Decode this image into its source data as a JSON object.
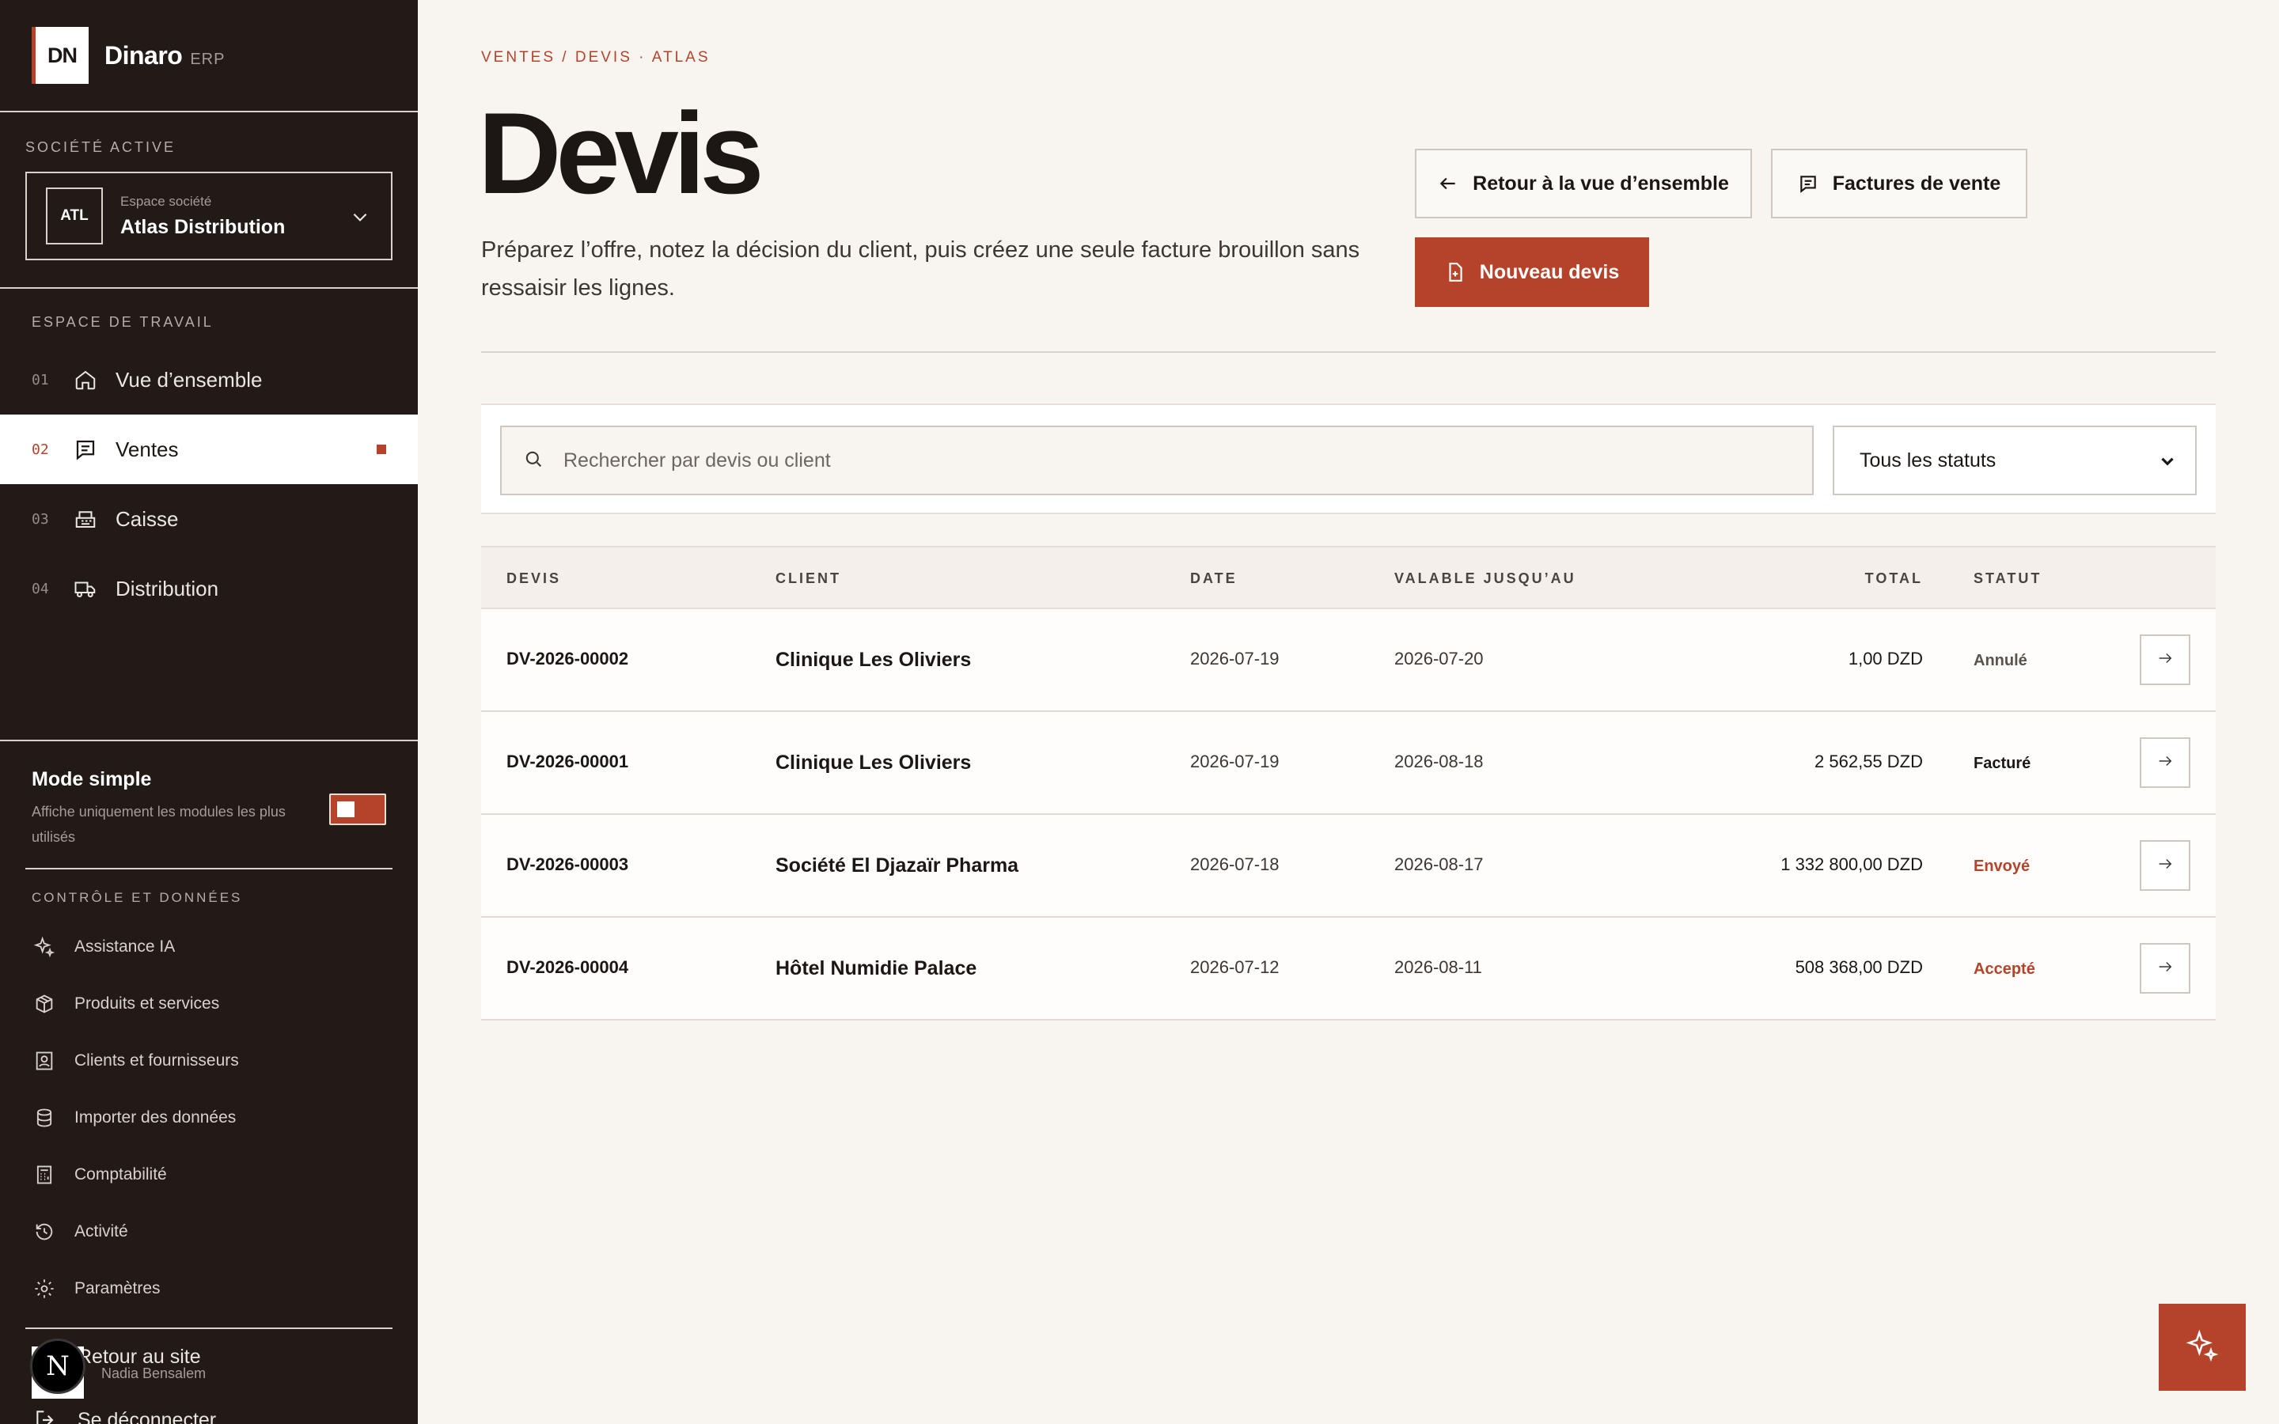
{
  "brand": {
    "logo": "DN",
    "name": "Dinaro",
    "suffix": "ERP"
  },
  "company": {
    "section_label": "SOCIÉTÉ ACTIVE",
    "badge": "ATL",
    "subtitle": "Espace société",
    "name": "Atlas Distribution"
  },
  "workspace": {
    "section_label": "ESPACE DE TRAVAIL",
    "items": [
      {
        "num": "01",
        "label": "Vue d’ensemble",
        "icon": "home-icon"
      },
      {
        "num": "02",
        "label": "Ventes",
        "icon": "receipt-icon",
        "active": true
      },
      {
        "num": "03",
        "label": "Caisse",
        "icon": "cash-register-icon"
      },
      {
        "num": "04",
        "label": "Distribution",
        "icon": "truck-icon"
      }
    ]
  },
  "simple_mode": {
    "title": "Mode simple",
    "description": "Affiche uniquement les modules les plus utilisés",
    "enabled": true
  },
  "control": {
    "section_label": "CONTRÔLE ET DONNÉES",
    "items": [
      {
        "label": "Assistance IA",
        "icon": "sparkles-icon"
      },
      {
        "label": "Produits et services",
        "icon": "box-icon"
      },
      {
        "label": "Clients et fournisseurs",
        "icon": "contacts-icon"
      },
      {
        "label": "Importer des données",
        "icon": "database-icon"
      },
      {
        "label": "Comptabilité",
        "icon": "calculator-icon"
      },
      {
        "label": "Activité",
        "icon": "history-icon"
      },
      {
        "label": "Paramètres",
        "icon": "gear-icon"
      }
    ]
  },
  "bottom_links": [
    {
      "label": "Retour au site",
      "icon": "arrow-left-icon"
    },
    {
      "label": "Se déconnecter",
      "icon": "logout-icon"
    }
  ],
  "user": {
    "initial": "N",
    "name": "Nadia Bensalem"
  },
  "page": {
    "breadcrumb": "VENTES / DEVIS · ATLAS",
    "title": "Devis",
    "intro": "Préparez l’offre, notez la décision du client, puis créez une seule facture brouillon sans ressaisir les lignes.",
    "buttons": {
      "back": "Retour à la vue d’ensemble",
      "invoices": "Factures de vente",
      "new": "Nouveau devis"
    }
  },
  "filters": {
    "search_placeholder": "Rechercher par devis ou client",
    "status_selected": "Tous les statuts"
  },
  "table": {
    "headers": {
      "number": "DEVIS",
      "client": "CLIENT",
      "date": "DATE",
      "valid_until": "VALABLE JUSQU’AU",
      "total": "TOTAL",
      "status": "STATUT"
    },
    "rows": [
      {
        "number": "DV-2026-00002",
        "client": "Clinique Les Oliviers",
        "date": "2026-07-19",
        "valid_until": "2026-07-20",
        "total": "1,00 DZD",
        "status": "Annulé",
        "status_color": "#5a524c"
      },
      {
        "number": "DV-2026-00001",
        "client": "Clinique Les Oliviers",
        "date": "2026-07-19",
        "valid_until": "2026-08-18",
        "total": "2 562,55 DZD",
        "status": "Facturé",
        "status_color": "#1c1714"
      },
      {
        "number": "DV-2026-00003",
        "client": "Société El Djazaïr Pharma",
        "date": "2026-07-18",
        "valid_until": "2026-08-17",
        "total": "1 332 800,00 DZD",
        "status": "Envoyé",
        "status_color": "#b5432a"
      },
      {
        "number": "DV-2026-00004",
        "client": "Hôtel Numidie Palace",
        "date": "2026-07-12",
        "valid_until": "2026-08-11",
        "total": "508 368,00 DZD",
        "status": "Accepté",
        "status_color": "#b5432a"
      }
    ]
  },
  "colors": {
    "accent": "#b5432a",
    "sidebar": "#211a17",
    "background": "#f8f5f0"
  }
}
